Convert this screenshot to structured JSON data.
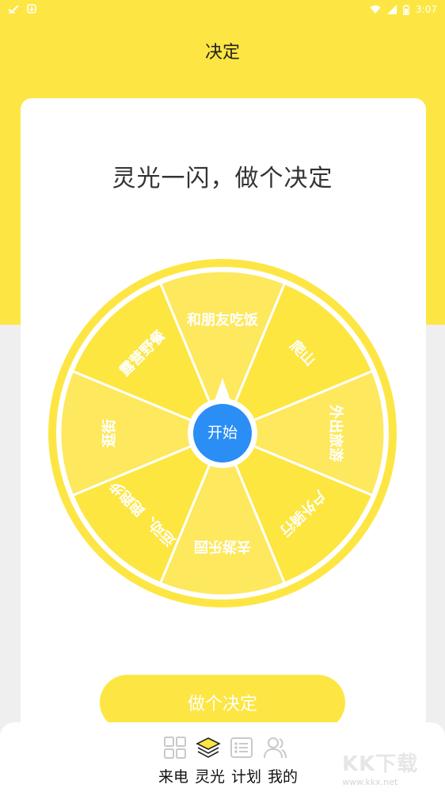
{
  "status_bar": {
    "time": "3:07",
    "icons": [
      "check-icon",
      "download-icon",
      "wifi-icon",
      "signal-icon",
      "battery-icon"
    ]
  },
  "header": {
    "title": "决定"
  },
  "card": {
    "headline": "灵光一闪，做个决定"
  },
  "wheel": {
    "center_label": "开始",
    "colors": {
      "dark": "#fde640",
      "light": "#fde85e",
      "rim": "#fde643",
      "center": "#2a8ef5"
    },
    "segments": [
      {
        "label": "和朋友吃饭",
        "shade": "light"
      },
      {
        "label": "爬山",
        "shade": "dark"
      },
      {
        "label": "外出旅游",
        "shade": "light"
      },
      {
        "label": "户外骑行",
        "shade": "dark"
      },
      {
        "label": "去游乐园",
        "shade": "light"
      },
      {
        "label": "运动、跑跑步",
        "shade": "dark"
      },
      {
        "label": "逛街",
        "shade": "light"
      },
      {
        "label": "露营野餐",
        "shade": "dark"
      }
    ]
  },
  "actions": {
    "decide_label": "做个决定"
  },
  "nav": {
    "items": [
      {
        "label": "来电",
        "icon": "grid-icon"
      },
      {
        "label": "灵光",
        "icon": "layers-icon"
      },
      {
        "label": "计划",
        "icon": "list-icon"
      },
      {
        "label": "我的",
        "icon": "user-icon"
      }
    ]
  },
  "watermark": {
    "title": "KK下载",
    "url": "www.kkx.net"
  },
  "theme": {
    "accent": "#fde643"
  }
}
